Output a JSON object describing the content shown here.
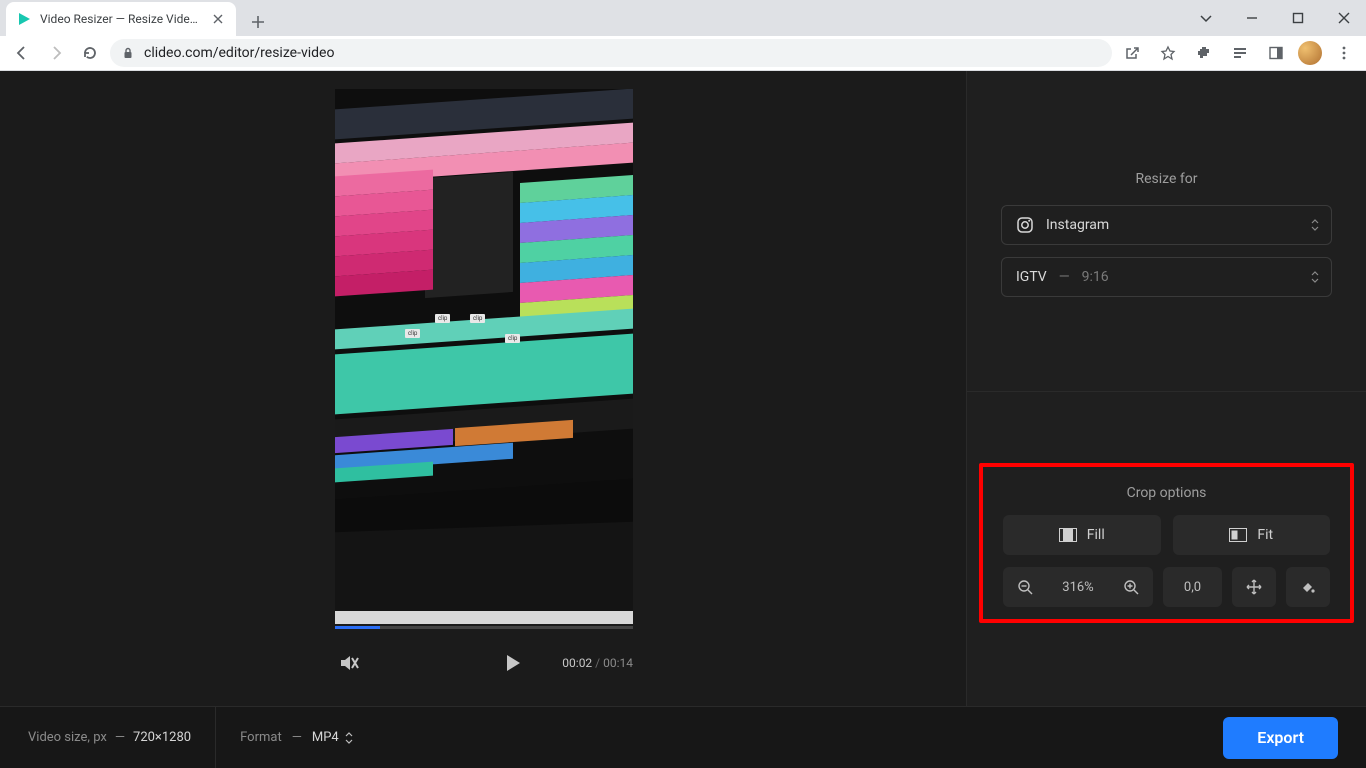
{
  "browser": {
    "tab_title": "Video Resizer — Resize Video On",
    "url": "clideo.com/editor/resize-video"
  },
  "sidebar": {
    "resize_title": "Resize for",
    "platform": "Instagram",
    "preset_name": "IGTV",
    "preset_ratio": "9:16",
    "crop_title": "Crop options",
    "fill_label": "Fill",
    "fit_label": "Fit",
    "zoom_value": "316%",
    "position_value": "0,0"
  },
  "player": {
    "current_time": "00:02",
    "total_time": "00:14"
  },
  "bottom": {
    "size_label": "Video size, px",
    "size_value": "720×1280",
    "format_label": "Format",
    "format_value": "MP4",
    "export_label": "Export"
  }
}
